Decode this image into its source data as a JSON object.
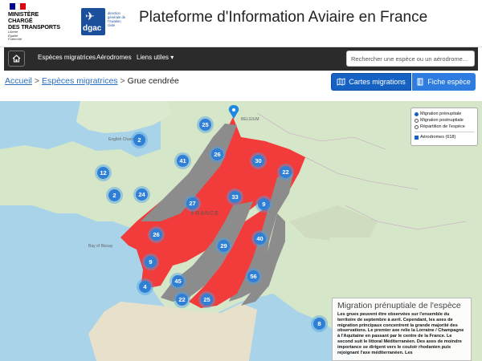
{
  "header": {
    "ministry_lines": [
      "MINISTÈRE",
      "CHARGÉ",
      "DES TRANSPORTS"
    ],
    "devise_lines": [
      "Liberté",
      "Égalité",
      "Fraternité"
    ],
    "dgac_logo_text": "dgac",
    "dgac_sub": "direction générale de l'Aviation civile",
    "site_title": "Plateforme d'Information Aviaire en France"
  },
  "nav": {
    "items": [
      "Espèces migratrices",
      "Aérodromes",
      "Liens utiles ▾"
    ],
    "search_placeholder": "Rechercher une espèce ou un aérodrome..."
  },
  "breadcrumb": {
    "home": "Accueil",
    "species": "Espèces migratrices",
    "current": "Grue cendrée",
    "separator": ">"
  },
  "buttons": {
    "migrations": "Cartes migrations",
    "fiche": "Fiche espèce"
  },
  "layers": {
    "options": [
      "Migration prénuptiale",
      "Migration postnuptiale",
      "Répartition de l'espèce"
    ],
    "selected": "Migration prénuptiale",
    "aerodromes": "Aérodromes (618)"
  },
  "map": {
    "clusters": [
      "25",
      "2",
      "26",
      "41",
      "30",
      "12",
      "22",
      "2",
      "24",
      "27",
      "33",
      "9",
      "26",
      "29",
      "40",
      "9",
      "45",
      "56",
      "4",
      "22",
      "25",
      "8"
    ],
    "labels": {
      "france": "FRANCE",
      "belgium": "BELGIUM",
      "english_channel": "English Channel",
      "bay_biscay": "Bay of Biscay"
    }
  },
  "info": {
    "title": "Migration prénuptiale de l'espèce",
    "text": "Les grues peuvent être observées sur l'ensemble du territoire de septembre à avril. Cependant, les axes de migration principaux concentrent la grande majorité des observations. Le premier axe relie la Lorraine / Champagne à l'Aquitaine en passant par le centre de la France. Le second suit le littoral Méditerranéen. Des axes de moindre importance se dirigent vers le couloir rhodanien puis rejoignant l'axe méditerranéen. Les"
  },
  "colors": {
    "primary_button": "#1662c4",
    "migration_red": "#f23b3b",
    "migration_gray": "#8c8c8c",
    "cluster_blue": "#2f7fd6",
    "nav_dark": "#2b2b2b"
  }
}
